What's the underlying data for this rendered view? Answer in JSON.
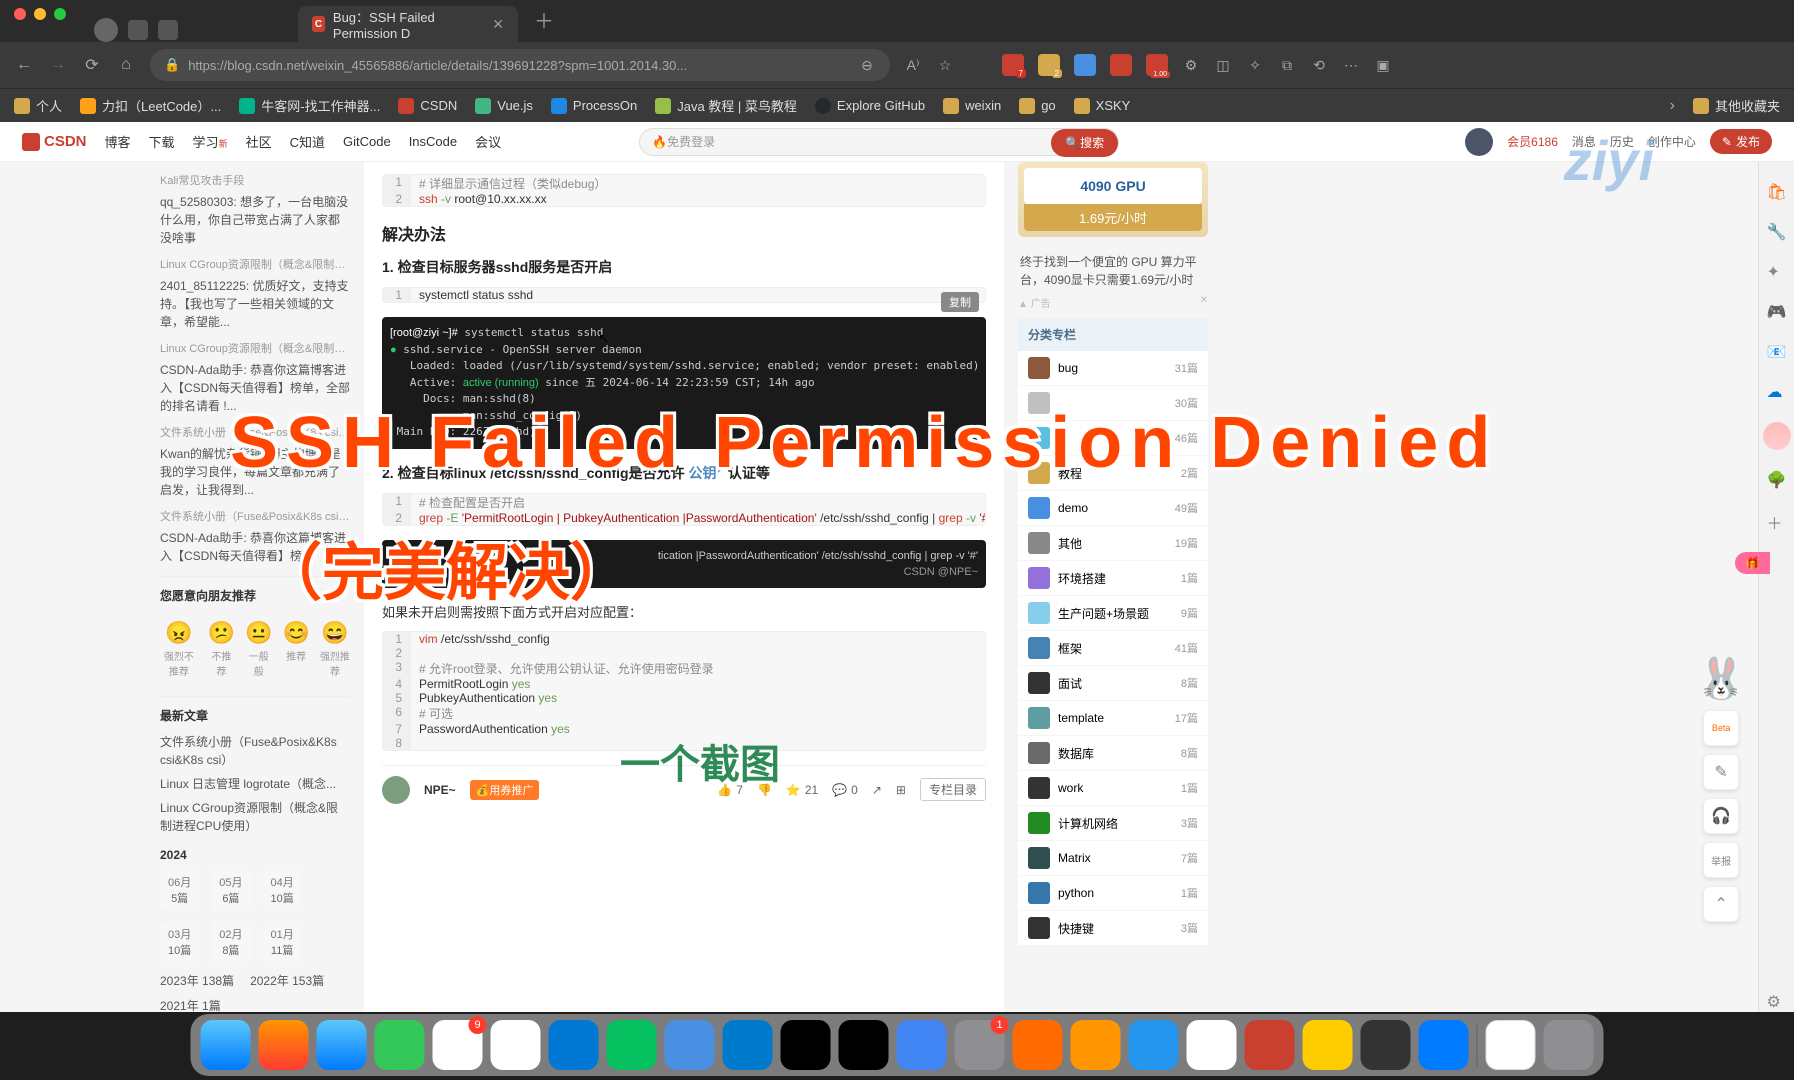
{
  "window": {
    "tab_title": "Bug：SSH Failed Permission D",
    "url": "https://blog.csdn.net/weixin_45565886/article/details/139691228?spm=1001.2014.30..."
  },
  "bookmarks": [
    {
      "label": "个人",
      "icon": "folder"
    },
    {
      "label": "力扣（LeetCode）...",
      "icon": "leetcode"
    },
    {
      "label": "牛客网-找工作神器...",
      "icon": "nowcoder"
    },
    {
      "label": "CSDN",
      "icon": "csdn"
    },
    {
      "label": "Vue.js",
      "icon": "vue"
    },
    {
      "label": "ProcessOn",
      "icon": "processon"
    },
    {
      "label": "Java 教程 | 菜鸟教程",
      "icon": "runoob"
    },
    {
      "label": "Explore GitHub",
      "icon": "github"
    },
    {
      "label": "weixin",
      "icon": "folder"
    },
    {
      "label": "go",
      "icon": "folder"
    },
    {
      "label": "XSKY",
      "icon": "folder"
    }
  ],
  "bookmarks_right": "其他收藏夹",
  "ext_badges": {
    "ext1": "7",
    "ext2": "2",
    "ext4": "1.00"
  },
  "csdn_nav": [
    "博客",
    "下载",
    "学习",
    "社区",
    "C知道",
    "GitCode",
    "InsCode",
    "会议"
  ],
  "csdn_nav_new": "新",
  "search_placeholder": "免费登录",
  "search_btn": "搜索",
  "header_right": {
    "members": "会员6186",
    "msg": "消息",
    "history": "历史",
    "create": "创作中心",
    "publish": "发布"
  },
  "watermark": "ziyi",
  "left_sidebar": {
    "groups": [
      {
        "title": "Kali常见攻击手段",
        "items": [
          "qq_52580303: 想多了，一台电脑没什么用，你自己带宽占满了人家都没啥事"
        ]
      },
      {
        "title": "Linux CGroup资源限制（概念&限制进程...",
        "items": [
          "2401_85112225: 优质好文，支持支持。【我也写了一些相关领域的文章，希望能..."
        ]
      },
      {
        "title": "Linux CGroup资源限制（概念&限制进程...",
        "items": [
          "CSDN-Ada助手: 恭喜你这篇博客进入【CSDN每天值得看】榜单，全部的排名请看 !..."
        ]
      },
      {
        "title": "文件系统小册（Fuse&Posix&K8s csi）...",
        "items": [
          "Kwan的解忧杂货铺: 博主的博客是我的学习良伴，每篇文章都充满了启发，让我得到..."
        ]
      },
      {
        "title": "文件系统小册（Fuse&Posix&K8s csi）...",
        "items": [
          "CSDN-Ada助手: 恭喜你这篇博客进入【CSDN每天值得看】榜..."
        ]
      }
    ],
    "recommend_title": "您愿意向朋友推荐",
    "emojis": [
      {
        "face": "😠",
        "label": "强烈不推荐"
      },
      {
        "face": "😕",
        "label": "不推荐"
      },
      {
        "face": "😐",
        "label": "一般般"
      },
      {
        "face": "😊",
        "label": "推荐"
      },
      {
        "face": "😄",
        "label": "强烈推荐"
      }
    ],
    "latest_title": "最新文章",
    "latest": [
      "文件系统小册（Fuse&Posix&K8s csi&K8s csi）",
      "Linux 日志管理 logrotate（概念...",
      "Linux CGroup资源限制（概念&限制进程CPU使用）"
    ],
    "archive": {
      "year": "2024",
      "months": [
        {
          "m": "06月",
          "c": "5篇"
        },
        {
          "m": "05月",
          "c": "6篇"
        },
        {
          "m": "04月",
          "c": "10篇"
        },
        {
          "m": "03月",
          "c": "10篇"
        },
        {
          "m": "02月",
          "c": "8篇"
        },
        {
          "m": "01月",
          "c": "11篇"
        }
      ],
      "years": [
        {
          "y": "2023年",
          "c": "138篇"
        },
        {
          "y": "2022年",
          "c": "153篇"
        },
        {
          "y": "2021年",
          "c": "1篇"
        }
      ]
    }
  },
  "article": {
    "code1_comment": "# 详细显示通信过程（类似debug）",
    "code1_cmd": "ssh -v root@10.xx.xx.xx",
    "h3_solution": "解决办法",
    "h4_check1": "1. 检查目标服务器sshd服务是否开启",
    "copy_label": "复制",
    "code2": "systemctl status sshd",
    "terminal1": "[root@ziyi ~]# systemctl status sshd\n● sshd.service - OpenSSH server daemon\n   Loaded: loaded (/usr/lib/systemd/system/sshd.service; enabled; vendor preset: enabled)\n   Active: active (running) since 五 2024-06-14 22:23:59 CST; 14h ago\n     Docs: man:sshd(8)\n           man:sshd_config(5)\n Main PID: 2267 (sshd)",
    "h4_check2_pre": "2. 检查目标linux /etc/ssh/sshd_config是否允许 ",
    "h4_check2_link": "公钥",
    "h4_check2_post": " 认证等",
    "code3_comment": "# 检查配置是否开启",
    "code3_cmd": "grep -E 'PermitRootLogin | PubkeyAuthentication |PasswordAuthentication' /etc/ssh/sshd_config | grep -v '#",
    "terminal2_right": "tication |PasswordAuthentication' /etc/ssh/sshd_config | grep -v '#'",
    "terminal2_brand": "CSDN @NPE~",
    "body_text": "如果未开启则需按照下面方式开启对应配置：",
    "code4": [
      {
        "n": "1",
        "t": "vim /etc/ssh/sshd_config",
        "cls": "cmd"
      },
      {
        "n": "2",
        "t": "",
        "cls": ""
      },
      {
        "n": "3",
        "t": "# 允许root登录、允许使用公钥认证、允许使用密码登录",
        "cls": "cmt"
      },
      {
        "n": "4",
        "t": "PermitRootLogin yes",
        "cls": ""
      },
      {
        "n": "5",
        "t": "PubkeyAuthentication yes",
        "cls": ""
      },
      {
        "n": "6",
        "t": "# 可选",
        "cls": "cmt"
      },
      {
        "n": "7",
        "t": "PasswordAuthentication yes",
        "cls": ""
      },
      {
        "n": "8",
        "t": "",
        "cls": ""
      }
    ],
    "footer": {
      "author": "NPE~",
      "promo": "用券推广",
      "like": "7",
      "star": "21",
      "comment": "0",
      "menu": "专栏目录"
    }
  },
  "right_sidebar": {
    "gpu_title": "4090 GPU",
    "gpu_price": "1.69元/小时",
    "ad_text": "终于找到一个便宜的 GPU 算力平台，4090显卡只需要1.69元/小时",
    "ad_tag": "广告",
    "section": "分类专栏",
    "categories": [
      {
        "name": "bug",
        "count": "31篇",
        "color": "#8b5a3c"
      },
      {
        "name": "",
        "count": "30篇",
        "color": "#c0c0c0"
      },
      {
        "name": "",
        "count": "46篇",
        "color": "#5bc0de"
      },
      {
        "name": "教程",
        "count": "2篇",
        "color": "#d4a94e"
      },
      {
        "name": "demo",
        "count": "49篇",
        "color": "#4a90e2"
      },
      {
        "name": "其他",
        "count": "19篇",
        "color": "#888"
      },
      {
        "name": "环境搭建",
        "count": "1篇",
        "color": "#9370db"
      },
      {
        "name": "生产问题+场景题",
        "count": "9篇",
        "color": "#87ceeb"
      },
      {
        "name": "框架",
        "count": "41篇",
        "color": "#4682b4"
      },
      {
        "name": "面试",
        "count": "8篇",
        "color": "#333"
      },
      {
        "name": "template",
        "count": "17篇",
        "color": "#5f9ea0"
      },
      {
        "name": "数据库",
        "count": "8篇",
        "color": "#696969"
      },
      {
        "name": "work",
        "count": "1篇",
        "color": "#333"
      },
      {
        "name": "计算机网络",
        "count": "3篇",
        "color": "#228b22"
      },
      {
        "name": "Matrix",
        "count": "7篇",
        "color": "#2f4f4f"
      },
      {
        "name": "python",
        "count": "1篇",
        "color": "#3776ab"
      },
      {
        "name": "快捷键",
        "count": "3篇",
        "color": "#333"
      }
    ]
  },
  "overlay": {
    "title": "SSH Failed Permission Denied",
    "subtitle": "（完美解决）",
    "screenshot": "一个截图"
  },
  "float": {
    "beta": "Beta",
    "newlabel": "举报"
  },
  "dock_badges": {
    "mail": "9",
    "settings": "1"
  }
}
